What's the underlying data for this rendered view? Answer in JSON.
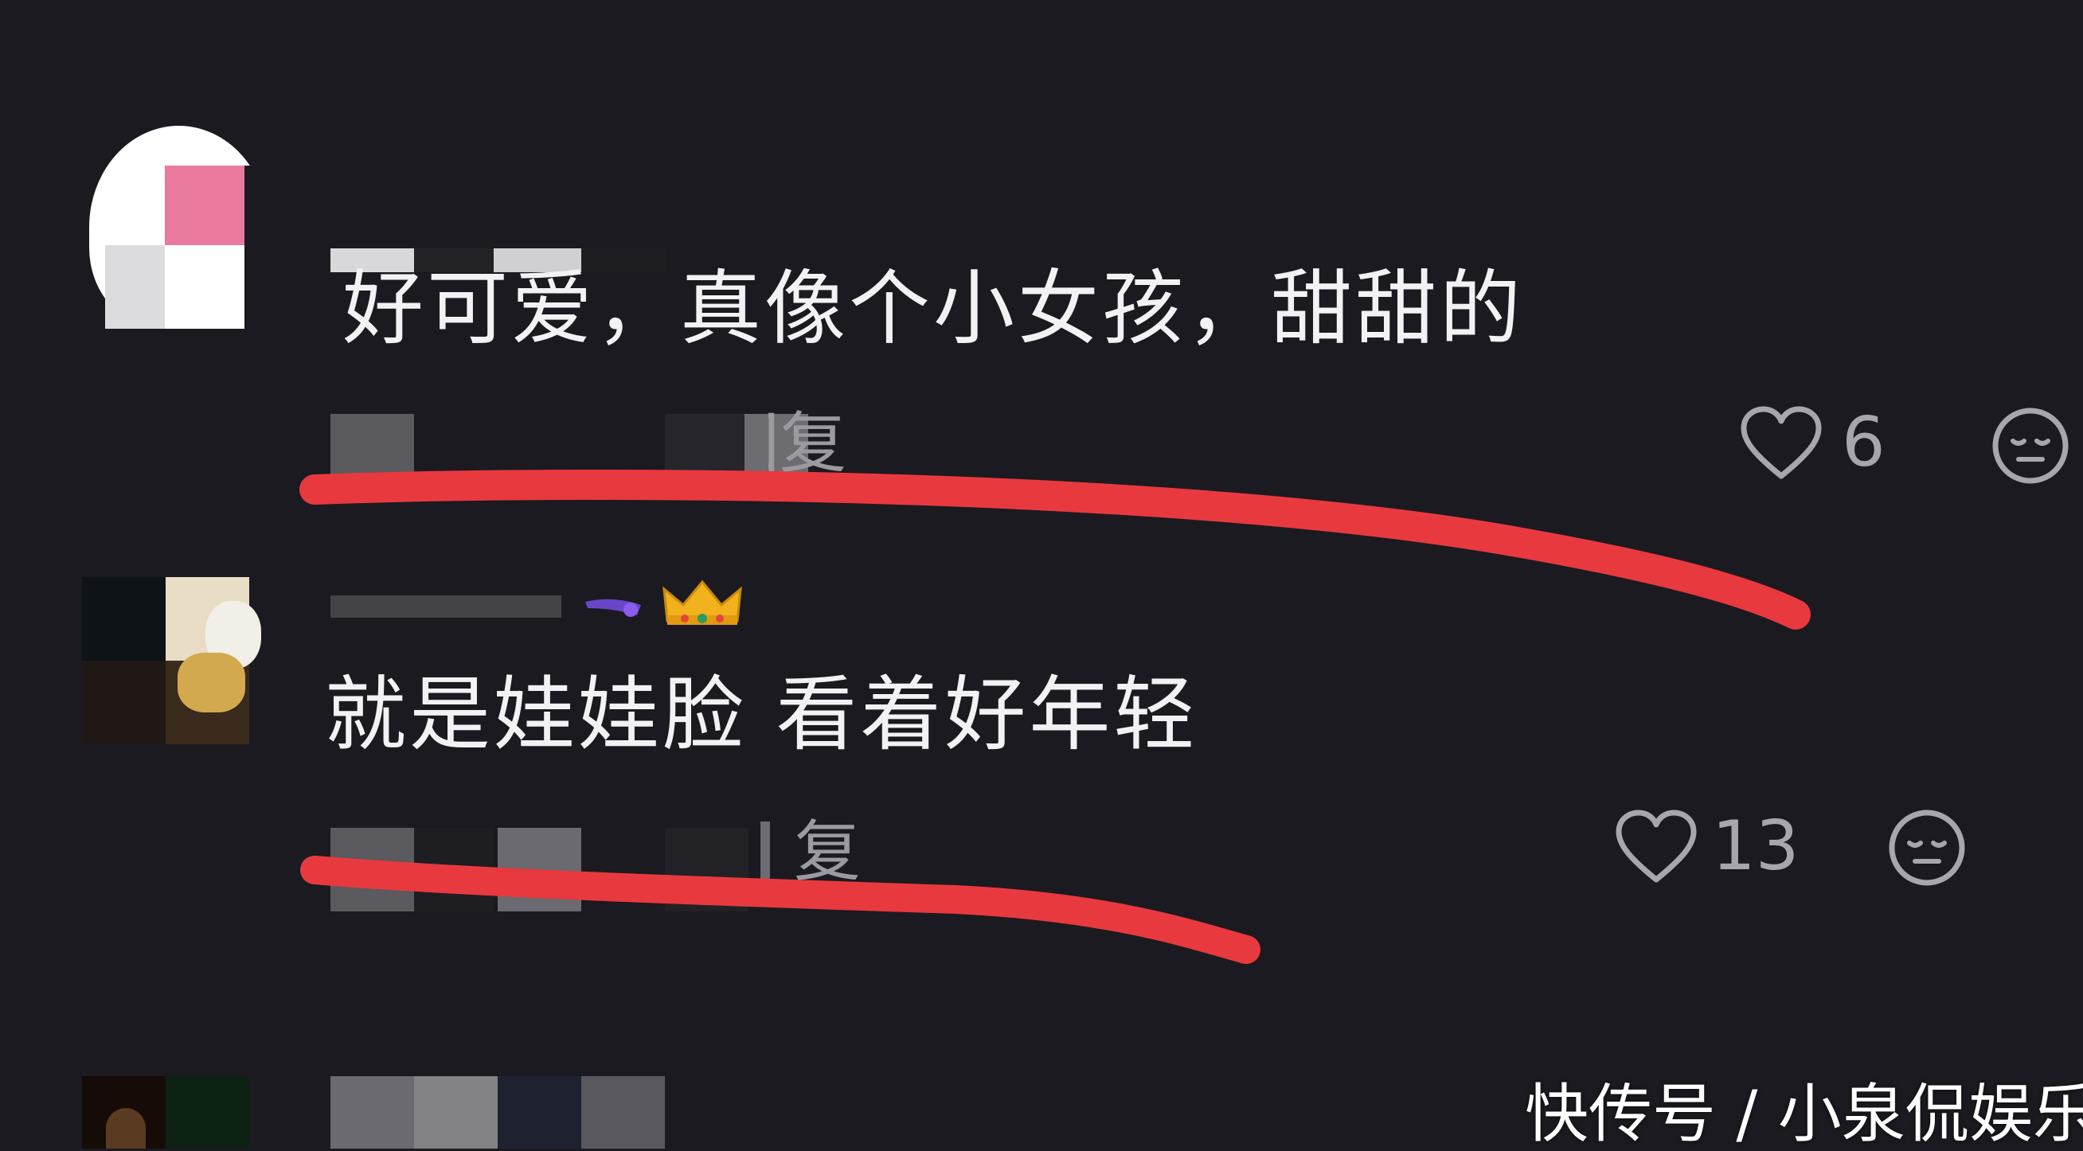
{
  "comments": [
    {
      "text": "好可爱，真像个小女孩，甜甜的",
      "reply_label": "回复",
      "likes": "6"
    },
    {
      "text": "就是娃娃脸 看着好年轻",
      "reply_label": "复",
      "likes": "13"
    }
  ],
  "watermark": "快传号 / 小泉侃娱乐",
  "colors": {
    "background": "#1b1a20",
    "annotation_stroke": "#e8393f",
    "icon": "#a6a6ac"
  },
  "icons": [
    "heart-icon",
    "dislike-face-icon",
    "crown-emoji"
  ]
}
